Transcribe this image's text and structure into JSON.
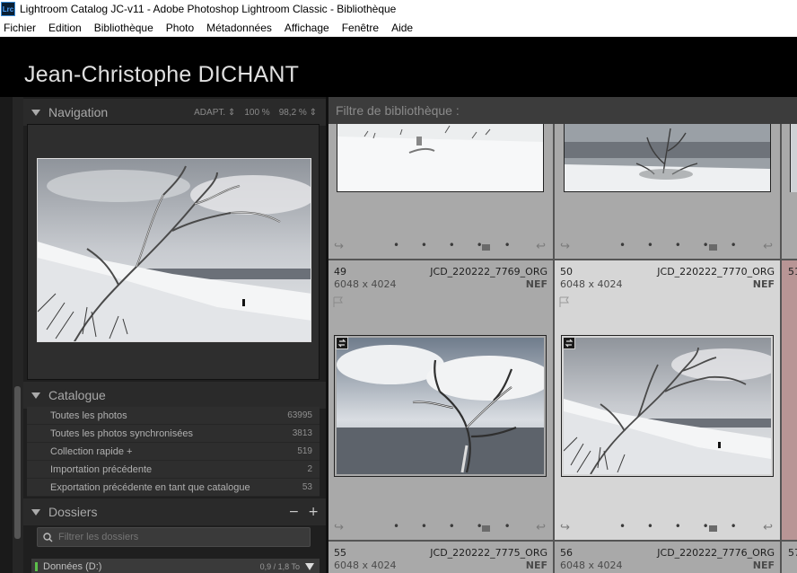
{
  "window": {
    "app_icon_text": "Lrc",
    "title": "Lightroom Catalog JC-v11 - Adobe Photoshop Lightroom Classic - Bibliothèque"
  },
  "menu": [
    "Fichier",
    "Edition",
    "Bibliothèque",
    "Photo",
    "Métadonnées",
    "Affichage",
    "Fenêtre",
    "Aide"
  ],
  "identity_plate": "Jean-Christophe DICHANT",
  "navigation": {
    "title": "Navigation",
    "zoom_fit": "ADAPT.",
    "zoom_100": "100 %",
    "zoom_custom": "98,2 %"
  },
  "catalogue": {
    "title": "Catalogue",
    "items": [
      {
        "label": "Toutes les photos",
        "count": "63995"
      },
      {
        "label": "Toutes les photos synchronisées",
        "count": "3813"
      },
      {
        "label": "Collection rapide +",
        "count": "519"
      },
      {
        "label": "Importation précédente",
        "count": "2"
      },
      {
        "label": "Exportation précédente en tant que catalogue",
        "count": "53"
      }
    ]
  },
  "dossiers": {
    "title": "Dossiers",
    "filter_placeholder": "Filtrer les dossiers",
    "volume": {
      "name": "Données (D:)",
      "size": "0,9 / 1,8 To"
    }
  },
  "library_filter": {
    "label": "Filtre de bibliothèque :"
  },
  "grid": {
    "cells": [
      {
        "num": "49",
        "file": "JCD_220222_7769_ORG",
        "dims": "6048 x 4024",
        "ext": "NEF"
      },
      {
        "num": "50",
        "file": "JCD_220222_7770_ORG",
        "dims": "6048 x 4024",
        "ext": "NEF"
      },
      {
        "num": "51",
        "file": "",
        "dims": "",
        "ext": ""
      },
      {
        "num": "55",
        "file": "JCD_220222_7775_ORG",
        "dims": "6048 x 4024",
        "ext": "NEF"
      },
      {
        "num": "56",
        "file": "JCD_220222_7776_ORG",
        "dims": "6048 x 4024",
        "ext": "NEF"
      },
      {
        "num": "57",
        "file": "",
        "dims": "",
        "ext": ""
      }
    ],
    "footer_dots": "• • • • •"
  },
  "colors": {
    "cell_gray": "#a9a9a9",
    "cell_selected": "#d6d6d6",
    "cell_rejected": "#b89595",
    "panel_bg": "#1f1f1f"
  }
}
